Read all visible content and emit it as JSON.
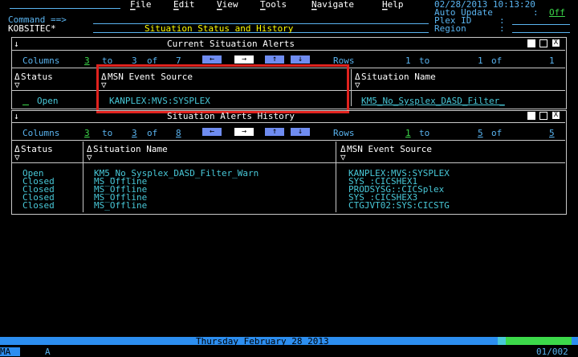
{
  "header": {
    "command_label": "Command ==>",
    "workspace": "KOBSITEC*",
    "menu": [
      "File",
      "Edit",
      "View",
      "Tools",
      "Navigate",
      "Help"
    ],
    "title": "Situation Status and History",
    "datetime": "02/28/2013 10:13:20",
    "auto_update_label": "Auto Update",
    "auto_update_sep": ":",
    "auto_update_value": "Off",
    "plex_label": "Plex ID",
    "plex_sep": ":",
    "region_label": "Region",
    "region_sep": ":"
  },
  "current_panel": {
    "title": "Current Situation Alerts",
    "columns_label": "Columns",
    "col_from": "3",
    "to_label": "to",
    "col_to": "3",
    "of_label": "of",
    "col_total": "7",
    "rows_label": "Rows",
    "row_from": "1",
    "row_to_label": "to",
    "row_to": "1",
    "row_of_label": "of",
    "row_total": "1",
    "headers": [
      "Status",
      "MSN Event Source",
      "Situation Name"
    ],
    "rows": [
      {
        "status": "Open",
        "source": "KANPLEX:MVS:SYSPLEX",
        "situation": "KM5_No_Sysplex_DASD_Filter_"
      }
    ]
  },
  "history_panel": {
    "title": "Situation Alerts History",
    "columns_label": "Columns",
    "col_from": "3",
    "to_label": "to",
    "col_to": "3",
    "of_label": "of",
    "col_total": "8",
    "rows_label": "Rows",
    "row_from": "1",
    "row_to_label": "to",
    "row_to": "5",
    "row_of_label": "of",
    "row_total": "5",
    "headers": [
      "Status",
      "Situation Name",
      "MSN Event Source"
    ],
    "rows": [
      {
        "status": "Open",
        "situation": "KM5_No_Sysplex_DASD_Filter_Warn",
        "source": "KANPLEX:MVS:SYSPLEX"
      },
      {
        "status": "Closed",
        "situation": "MS_Offline",
        "source": "SYS_:CICSHEX1"
      },
      {
        "status": "Closed",
        "situation": "MS_Offline",
        "source": "PRODSYSG::CICSplex"
      },
      {
        "status": "Closed",
        "situation": "MS_Offline",
        "source": "SYS_:CICSHEX3"
      },
      {
        "status": "Closed",
        "situation": "MS_Offline",
        "source": "CTGJVT02:SYS:CICSTG"
      }
    ]
  },
  "statusbar": {
    "date": "Thursday February 28 2013",
    "left_code": "MA",
    "session": "A",
    "page": "01/002"
  },
  "nav_arrows": [
    "←",
    "→",
    "↑",
    "↓"
  ],
  "sort_asc": "Δ",
  "sort_desc": "▽",
  "colors": {
    "blue": "#5ab4f0",
    "cyan": "#48c8d8",
    "green": "#3cd84a",
    "yellow": "#ffff00",
    "highlight": "#e0221e"
  }
}
